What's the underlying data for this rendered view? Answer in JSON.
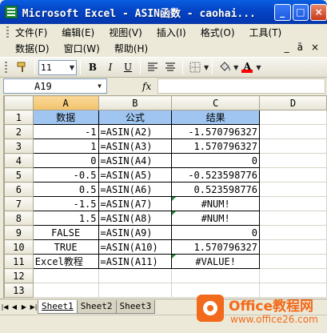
{
  "window": {
    "title": "Microsoft Excel - ASIN函数 - caohai..."
  },
  "menu": {
    "row1": [
      "文件(F)",
      "编辑(E)",
      "视图(V)",
      "插入(I)",
      "格式(O)",
      "工具(T)"
    ],
    "row2": [
      "数据(D)",
      "窗口(W)",
      "帮助(H)"
    ],
    "doc_controls": [
      "_",
      "ā",
      "×"
    ]
  },
  "toolbar": {
    "font_size": "11",
    "bold": "B",
    "italic": "I",
    "underline": "U",
    "font_color_letter": "A"
  },
  "formula_bar": {
    "name_box": "A19",
    "fx": "fx"
  },
  "columns": [
    "A",
    "B",
    "C",
    "D"
  ],
  "rows": [
    {
      "n": "1",
      "a": "数据",
      "b": "公式",
      "c": "结果"
    },
    {
      "n": "2",
      "a": "-1",
      "b": "=ASIN(A2)",
      "c": "-1.570796327"
    },
    {
      "n": "3",
      "a": "1",
      "b": "=ASIN(A3)",
      "c": "1.570796327"
    },
    {
      "n": "4",
      "a": "0",
      "b": "=ASIN(A4)",
      "c": "0"
    },
    {
      "n": "5",
      "a": "-0.5",
      "b": "=ASIN(A5)",
      "c": "-0.523598776"
    },
    {
      "n": "6",
      "a": "0.5",
      "b": "=ASIN(A6)",
      "c": "0.523598776"
    },
    {
      "n": "7",
      "a": "-1.5",
      "b": "=ASIN(A7)",
      "c": "#NUM!"
    },
    {
      "n": "8",
      "a": "1.5",
      "b": "=ASIN(A8)",
      "c": "#NUM!"
    },
    {
      "n": "9",
      "a": "FALSE",
      "b": "=ASIN(A9)",
      "c": "0"
    },
    {
      "n": "10",
      "a": "TRUE",
      "b": "=ASIN(A10)",
      "c": "1.570796327"
    },
    {
      "n": "11",
      "a": "Excel教程",
      "b": "=ASIN(A11)",
      "c": "#VALUE!"
    },
    {
      "n": "12",
      "a": "",
      "b": "",
      "c": ""
    },
    {
      "n": "13",
      "a": "",
      "b": "",
      "c": ""
    }
  ],
  "sheet_tabs": [
    "Sheet1",
    "Sheet2",
    "Sheet3"
  ],
  "watermark": {
    "name": "Office教程网",
    "url": "www.office26.com"
  },
  "colors": {
    "header_fill": "#9fc5f0",
    "title_bar": "#0446c8",
    "logo": "#f26a1b"
  }
}
